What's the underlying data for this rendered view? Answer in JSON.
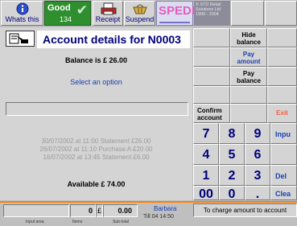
{
  "toolbar": {
    "whats_this_label": "Whats this",
    "good_label": "Good",
    "good_count": "134",
    "receipt_label": "Receipt",
    "suspend_label": "Suspend",
    "brand": "SPEDI",
    "copyright": "© STD Retail Solutions Ltd 1999 - 2004"
  },
  "account": {
    "title": "Account details for N0003",
    "balance": "Balance is  £  26.00",
    "prompt": "Select an option",
    "history": [
      "30/07/2002 at 11:00 Statement  £26.00",
      "26/07/2002 at 11:10 Purchase A  £20.00",
      "16/07/2002 at 13:45 Statement  £6.00"
    ],
    "available": "Available £  74.00"
  },
  "keypad": {
    "hide_balance": "Hide balance",
    "pay_amount": "Pay amount",
    "pay_balance": "Pay balance",
    "confirm_account": "Confirm account",
    "exit": "Exit",
    "input": "Inpu",
    "delete": "Del",
    "clear": "Clea",
    "keys": [
      "7",
      "8",
      "9",
      "4",
      "5",
      "6",
      "1",
      "2",
      "3",
      "00",
      "0",
      "."
    ]
  },
  "status": {
    "input_area_label": "Input area",
    "items_value": "0",
    "items_label": "Items",
    "currency": "£",
    "subtotal_value": "0.00",
    "subtotal_label": "Sub-total",
    "operator": "Barbara",
    "till": "Till 04  14:50",
    "message": "To charge amount to account"
  },
  "colors": {
    "accent_orange": "#ff8000",
    "title_navy": "#00007a",
    "good_green": "#2f8f2f",
    "exit_red": "#ff5a3c"
  }
}
